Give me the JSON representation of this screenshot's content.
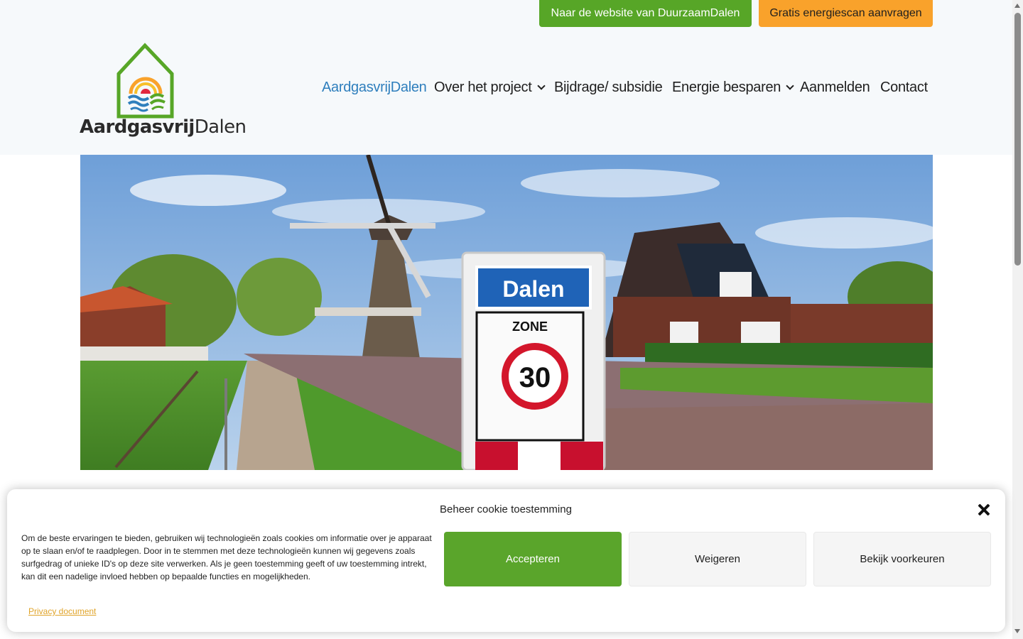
{
  "header": {
    "top_buttons": {
      "website": "Naar de website van DuurzaamDalen",
      "scan": "Gratis energiescan aanvragen"
    },
    "logo": {
      "text_bold": "Aardgasvrij",
      "text_regular": "Dalen"
    },
    "nav": [
      {
        "label": "AardgasvrijDalen",
        "active": true
      },
      {
        "label": "Over het project",
        "dropdown": true
      },
      {
        "label": "Bijdrage/ subsidie"
      },
      {
        "label": "Energie besparen",
        "dropdown": true
      },
      {
        "label": "Aanmelden"
      },
      {
        "label": "Contact"
      }
    ]
  },
  "hero": {
    "sign_town": "Dalen",
    "sign_zone": "ZONE",
    "sign_speed": "30"
  },
  "cookie": {
    "title": "Beheer cookie toestemming",
    "text": "Om de beste ervaringen te bieden, gebruiken wij technologieën zoals cookies om informatie over je apparaat op te slaan en/of te raadplegen. Door in te stemmen met deze technologieën kunnen wij gegevens zoals surfgedrag of unieke ID's op deze site verwerken. Als je geen toestemming geeft of uw toestemming intrekt, kan dit een nadelige invloed hebben op bepaalde functies en mogelijkheden.",
    "accept": "Accepteren",
    "deny": "Weigeren",
    "prefs": "Bekijk voorkeuren",
    "privacy": "Privacy document"
  },
  "colors": {
    "green": "#57a627",
    "orange": "#f9a22b",
    "active_nav": "#2f7fbd",
    "header_bg": "#f6f9fb"
  }
}
